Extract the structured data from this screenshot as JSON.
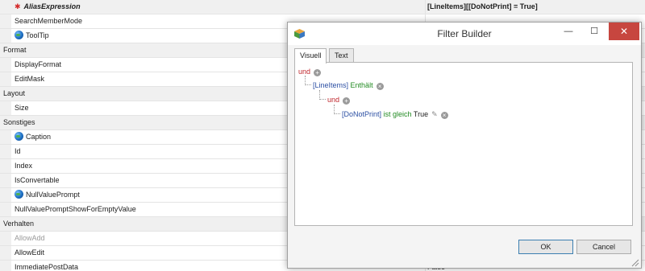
{
  "property_grid": {
    "rows": [
      {
        "kind": "prop",
        "icon": "asterisk",
        "name": "AliasExpression",
        "value": "[LineItems][[DoNotPrint] = True]",
        "selected": true
      },
      {
        "kind": "prop",
        "icon": "",
        "name": "SearchMemberMode",
        "value": ""
      },
      {
        "kind": "prop",
        "icon": "globe",
        "name": "ToolTip",
        "value": ""
      },
      {
        "kind": "cat",
        "name": "Format"
      },
      {
        "kind": "prop",
        "icon": "",
        "name": "DisplayFormat",
        "value": ""
      },
      {
        "kind": "prop",
        "icon": "",
        "name": "EditMask",
        "value": ""
      },
      {
        "kind": "cat",
        "name": "Layout"
      },
      {
        "kind": "prop",
        "icon": "",
        "name": "Size",
        "value": ""
      },
      {
        "kind": "cat",
        "name": "Sonstiges"
      },
      {
        "kind": "prop",
        "icon": "globe",
        "name": "Caption",
        "value": ""
      },
      {
        "kind": "prop",
        "icon": "",
        "name": "Id",
        "value": ""
      },
      {
        "kind": "prop",
        "icon": "",
        "name": "Index",
        "value": ""
      },
      {
        "kind": "prop",
        "icon": "",
        "name": "IsConvertable",
        "value": ""
      },
      {
        "kind": "prop",
        "icon": "globe",
        "name": "NullValuePrompt",
        "value": ""
      },
      {
        "kind": "prop",
        "icon": "",
        "name": "NullValuePromptShowForEmptyValue",
        "value": ""
      },
      {
        "kind": "cat",
        "name": "Verhalten"
      },
      {
        "kind": "prop",
        "icon": "",
        "name": "AllowAdd",
        "value": "",
        "dim": true
      },
      {
        "kind": "prop",
        "icon": "",
        "name": "AllowEdit",
        "value": ""
      },
      {
        "kind": "prop",
        "icon": "",
        "name": "ImmediatePostData",
        "value": "False"
      }
    ]
  },
  "dialog": {
    "title": "Filter Builder",
    "window_buttons": {
      "minimize": "—",
      "maximize": "☐",
      "close": "✕"
    },
    "tabs": [
      {
        "label": "Visuell",
        "active": true
      },
      {
        "label": "Text",
        "active": false
      }
    ],
    "tree": {
      "root_op": "und",
      "collection_field": "[LineItems]",
      "collection_func": "Enthält",
      "inner_op": "und",
      "condition_field": "[DoNotPrint]",
      "condition_op": "ist gleich",
      "condition_value": "True"
    },
    "ok_label": "OK",
    "cancel_label": "Cancel"
  },
  "colors": {
    "operator": "#c0272d",
    "field": "#2b4fa3",
    "function": "#228b22",
    "close_button": "#c7463f"
  }
}
